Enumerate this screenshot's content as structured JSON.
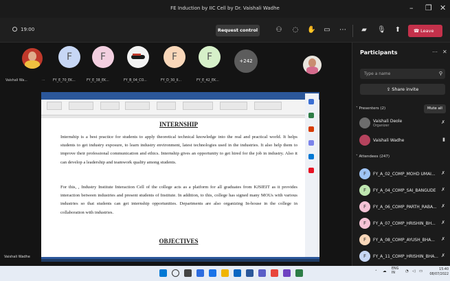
{
  "window": {
    "title": "FE Induction by IIC Cell by Dr. Vaishali Wadhe"
  },
  "toolbar": {
    "timer": "19:00",
    "request_control": "Request control",
    "leave": "Leave",
    "leave_color": "#c4314b"
  },
  "video_strip": {
    "tiles": [
      {
        "name": "Vaishali Wa...",
        "kind": "photo"
      },
      {
        "name": "FY_E_70_EK...",
        "initial": "F",
        "color": "#c7d7f5"
      },
      {
        "name": "FY_E_38_EK...",
        "initial": "F",
        "color": "#f3cfe0"
      },
      {
        "name": "FY_B_04_CO...",
        "kind": "image"
      },
      {
        "name": "FY_D_30_II...",
        "initial": "F",
        "color": "#f9d7b9"
      },
      {
        "name": "FY_E_42_EK...",
        "initial": "F",
        "color": "#d6f0c9"
      }
    ],
    "more_count": "+242"
  },
  "shared_doc": {
    "heading1": "INTERNSHIP",
    "para1": "Internship is a best practice for students to apply theoretical technical knowledge into the real and practical world. It helps students to get industry exposure, to learn industry environment, latest technologies used in the industries. It also help them to improve their professional communication and ethics. Internship gives an opportunity to get hired for the job in industry. Also it can develop a leadership and teamwork quality among students.",
    "para2": "For this, , Industry Institute Interaction Cell of the college acts as a platform for all graduates from KJSIEIT as it provides interaction between industries and present students of Institute. In addition, to this, college has signed many MOUs with various industries so that students can get internship opportunities. Departments are also organizing In-house in the college in collaboration with industries.",
    "heading2": "OBJECTIVES"
  },
  "speaker_label": "Vaishali Wadhe",
  "participants": {
    "title": "Participants",
    "search_placeholder": "Type a name",
    "share_invite": "Share invite",
    "presenters_label": "Presenters (2)",
    "mute_all": "Mute all",
    "presenters": [
      {
        "name": "Vaishali Deole",
        "role": "Organizer"
      },
      {
        "name": "Vaishali Wadhe",
        "role": ""
      }
    ],
    "attendees_label": "Attendees (247)",
    "attendees": [
      {
        "name": "FY_A_02_COMP_MOHD UMAI...",
        "color": "#9fc4f5"
      },
      {
        "name": "FY_A_04_COMP_SAI_BANGUDE",
        "color": "#bfe6b0"
      },
      {
        "name": "FY_A_06_COMP_PARTH_RABA...",
        "color": "#f5c3d6"
      },
      {
        "name": "FY_A_07_COMP_HRISHIN_BH...",
        "color": "#f5c3d6"
      },
      {
        "name": "FY_A_08_COMP_AYUSH_BHA...",
        "color": "#f9d7b9"
      },
      {
        "name": "FY_A_11_COMP_HRISHIN_BHA...",
        "color": "#c7d7f5"
      }
    ]
  },
  "system_tray": {
    "lang": "ENG",
    "region": "IN",
    "time": "15:40",
    "date": "08/07/2022"
  }
}
